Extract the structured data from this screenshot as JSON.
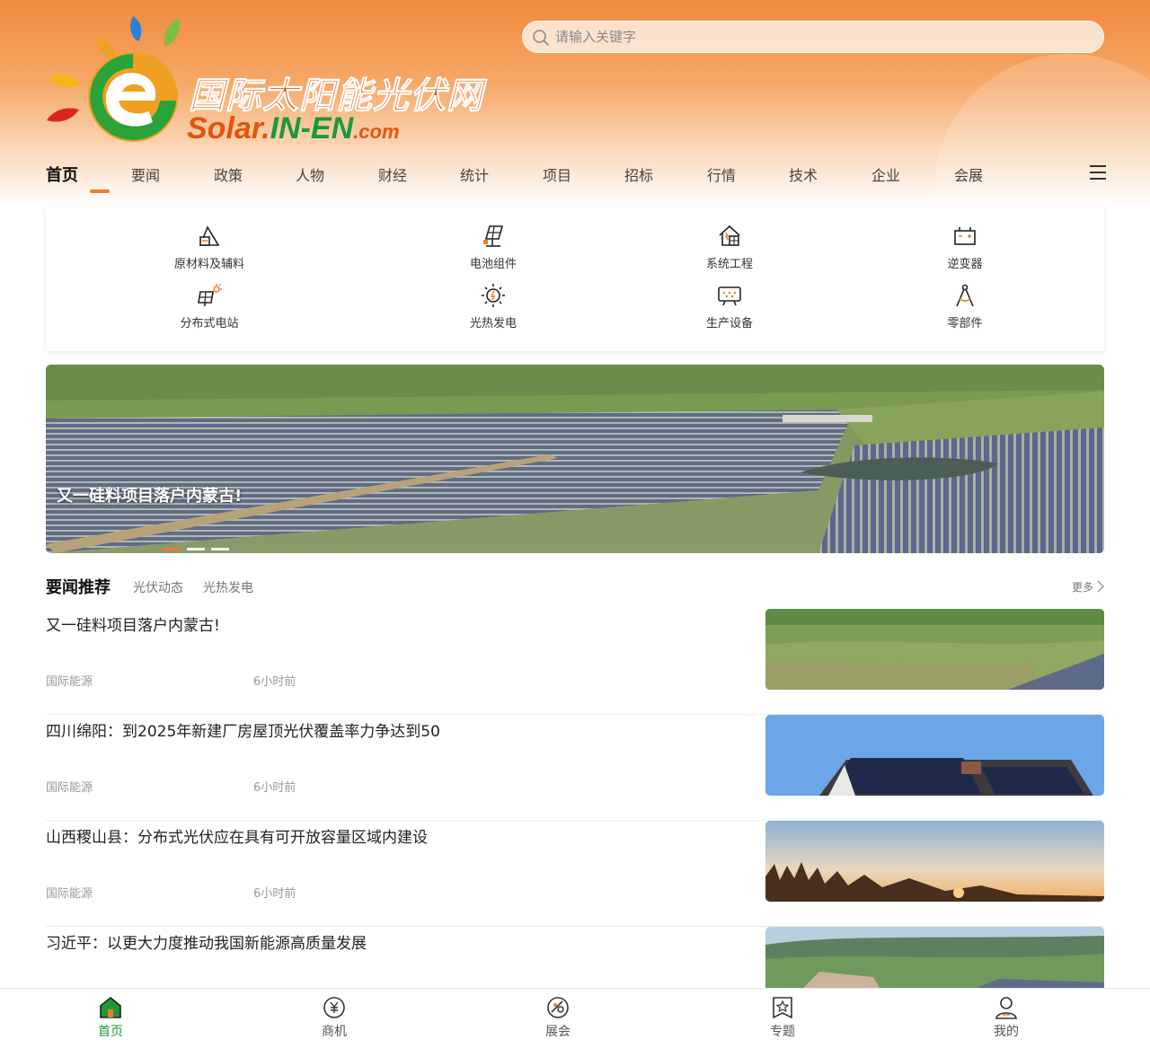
{
  "header": {
    "logo": {
      "cn": "国际太阳能光伏网",
      "en_part1": "Solar.",
      "en_part2": "IN-EN",
      "en_part3": ".com"
    },
    "search": {
      "placeholder": "请输入关键字",
      "value": ""
    }
  },
  "nav": {
    "items": [
      "首页",
      "要闻",
      "政策",
      "人物",
      "财经",
      "统计",
      "项目",
      "招标",
      "行情",
      "技术",
      "企业",
      "会展"
    ],
    "active": "首页"
  },
  "categories": [
    {
      "label": "原材料及辅料",
      "icon": "raw-material-icon"
    },
    {
      "label": "电池组件",
      "icon": "solar-panel-icon"
    },
    {
      "label": "系统工程",
      "icon": "house-system-icon"
    },
    {
      "label": "逆变器",
      "icon": "inverter-icon"
    },
    {
      "label": "分布式电站",
      "icon": "distributed-station-icon"
    },
    {
      "label": "光热发电",
      "icon": "sun-icon"
    },
    {
      "label": "生产设备",
      "icon": "equipment-icon"
    },
    {
      "label": "零部件",
      "icon": "compass-icon"
    }
  ],
  "banner": {
    "caption": "又一硅料项目落户内蒙古!",
    "slides": 3,
    "active_slide": 1
  },
  "section": {
    "title": "要闻推荐",
    "tabs": [
      "光伏动态",
      "光热发电"
    ],
    "more": "更多"
  },
  "news": [
    {
      "title": "又一硅料项目落户内蒙古!",
      "source": "国际能源",
      "time": "6小时前",
      "thumb": "grassland-solar"
    },
    {
      "title": "四川绵阳：到2025年新建厂房屋顶光伏覆盖率力争达到50",
      "source": "国际能源",
      "time": "6小时前",
      "thumb": "rooftop-solar"
    },
    {
      "title": "山西稷山县：分布式光伏应在具有可开放容量区域内建设",
      "source": "国际能源",
      "time": "6小时前",
      "thumb": "sunset-trees"
    },
    {
      "title": "习近平：以更大力度推动我国新能源高质量发展",
      "source": "",
      "time": "",
      "thumb": "hill-solar"
    }
  ],
  "tabbar": [
    {
      "label": "首页",
      "icon": "home-icon",
      "active": true
    },
    {
      "label": "商机",
      "icon": "yuan-coin-icon",
      "active": false
    },
    {
      "label": "展会",
      "icon": "exhibition-icon",
      "active": false
    },
    {
      "label": "专题",
      "icon": "topic-star-icon",
      "active": false
    },
    {
      "label": "我的",
      "icon": "user-icon",
      "active": false
    }
  ],
  "colors": {
    "accent": "#f07b2b",
    "brand_green": "#1a9a3a",
    "brand_orange": "#e4540b"
  }
}
